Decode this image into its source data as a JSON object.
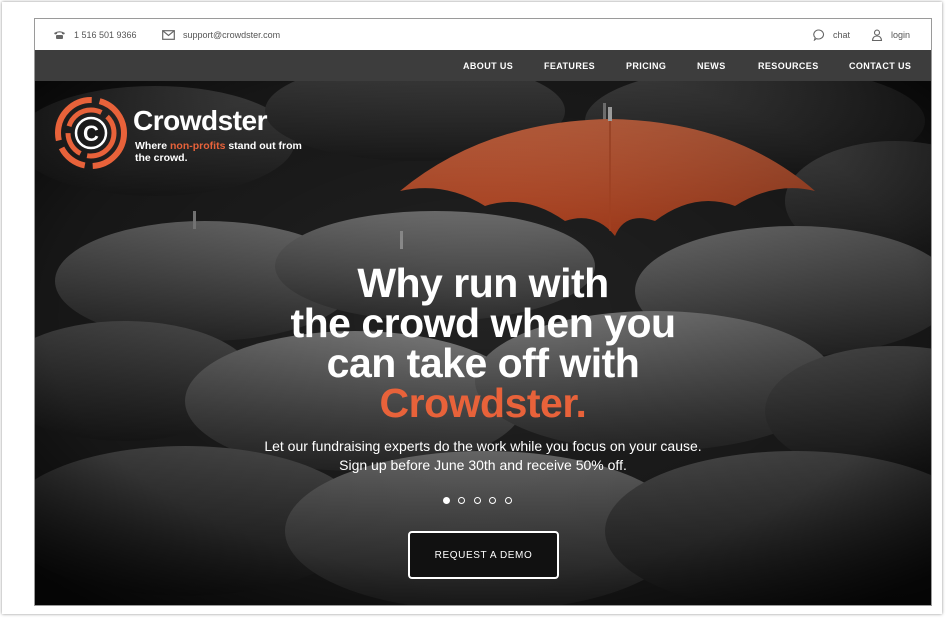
{
  "topbar": {
    "phone": "1 516 501 9366",
    "email": "support@crowdster.com",
    "chat_label": "chat",
    "login_label": "login"
  },
  "nav": {
    "items": [
      {
        "label": "ABOUT US"
      },
      {
        "label": "FEATURES"
      },
      {
        "label": "PRICING"
      },
      {
        "label": "NEWS"
      },
      {
        "label": "RESOURCES"
      },
      {
        "label": "CONTACT US"
      }
    ]
  },
  "logo": {
    "wordmark": "Crowdster",
    "tagline_prefix": "Where ",
    "tagline_highlight": "non-profits",
    "tagline_suffix": " stand out from the crowd.",
    "letter": "C"
  },
  "hero": {
    "headline_line1": "Why run with",
    "headline_line2": "the crowd when you",
    "headline_line3": "can take off with",
    "headline_accent": "Crowdster.",
    "subtext_line1": "Let our fundraising experts do the work while you focus on your cause.",
    "subtext_line2": "Sign up before June 30th and receive 50% off.",
    "cta_label": "REQUEST A DEMO",
    "slide_count": 5,
    "active_slide": 1
  },
  "colors": {
    "accent": "#e8623a",
    "nav_bg": "#3d3d3d",
    "hero_bg": "#1b1b1b"
  },
  "icons": {
    "phone": "phone-icon",
    "email": "mail-icon",
    "chat": "chat-bubble-icon",
    "login": "user-icon"
  }
}
